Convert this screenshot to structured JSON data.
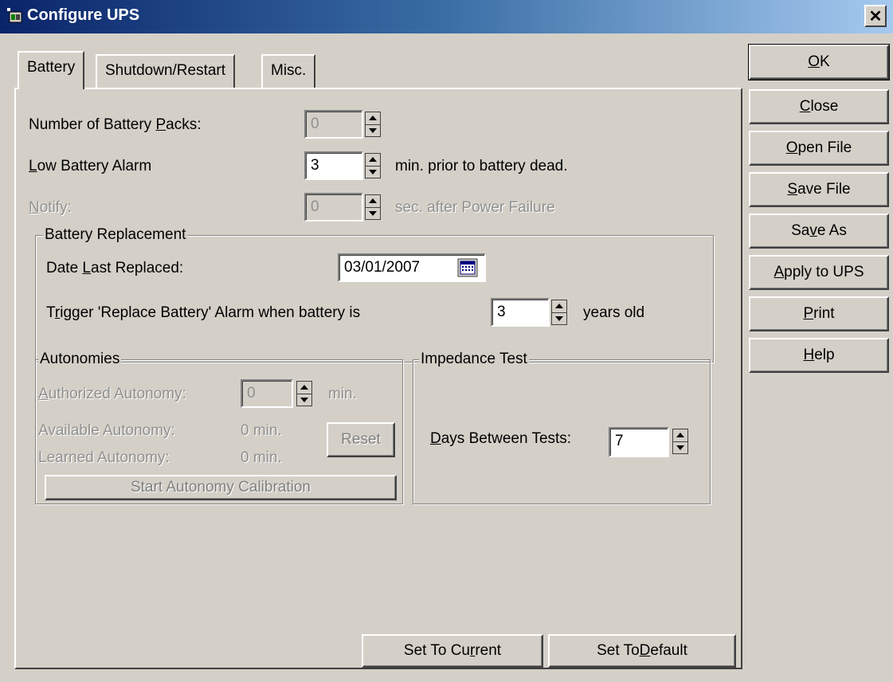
{
  "window": {
    "title": "Configure UPS",
    "app_icon": "ups-app-icon",
    "close_glyph": "✕"
  },
  "tabs": [
    {
      "label": "Battery",
      "active": true
    },
    {
      "label": "Shutdown/Restart",
      "active": false
    },
    {
      "label": "Misc.",
      "active": false
    }
  ],
  "battery": {
    "packs_label_pre": "Number of Battery ",
    "packs_label_u": "P",
    "packs_label_post": "acks:",
    "packs_value": "0",
    "low_alarm_label_u": "L",
    "low_alarm_label_post": "ow Battery Alarm",
    "low_alarm_value": "3",
    "low_alarm_suffix": "min. prior to battery dead.",
    "notify_label_u": "N",
    "notify_label_post": "otify:",
    "notify_value": "0",
    "notify_suffix": "sec. after Power Failure"
  },
  "replacement": {
    "group_title": "Battery Replacement",
    "date_label_pre": "Date ",
    "date_label_u": "L",
    "date_label_post": "ast Replaced:",
    "date_value": "03/01/2007",
    "trigger_label_pre": "T",
    "trigger_label_u": "r",
    "trigger_label_post": "igger 'Replace Battery' Alarm when battery is",
    "trigger_value": "3",
    "trigger_suffix": "years old"
  },
  "autonomies": {
    "group_title": "Autonomies",
    "authorized_label_u": "A",
    "authorized_label_post": "uthorized Autonomy:",
    "authorized_value": "0",
    "authorized_unit": "min.",
    "available_label": "Available Autonomy:",
    "available_value": "0 min.",
    "learned_label": "Learned Autonomy:",
    "learned_value": "0 min.",
    "reset_label": "Reset",
    "calibration_label": "Start Autonomy Calibration"
  },
  "impedance": {
    "group_title": "Impedance Test",
    "days_label_u": "D",
    "days_label_post": "ays Between Tests:",
    "days_value": "7"
  },
  "bottom_buttons": {
    "set_current_pre": "Set To Cu",
    "set_current_u": "r",
    "set_current_post": "rent",
    "set_default_pre": "Set To ",
    "set_default_u": "D",
    "set_default_post": "efault"
  },
  "side_buttons": [
    {
      "pre": "",
      "u": "O",
      "post": "K"
    },
    {
      "pre": "",
      "u": "C",
      "post": "lose"
    },
    {
      "pre": "",
      "u": "O",
      "post": "pen File"
    },
    {
      "pre": "",
      "u": "S",
      "post": "ave File"
    },
    {
      "pre": "Sa",
      "u": "v",
      "post": "e As"
    },
    {
      "pre": "",
      "u": "A",
      "post": "pply to UPS"
    },
    {
      "pre": "",
      "u": "P",
      "post": "rint"
    },
    {
      "pre": "",
      "u": "H",
      "post": "elp"
    }
  ]
}
